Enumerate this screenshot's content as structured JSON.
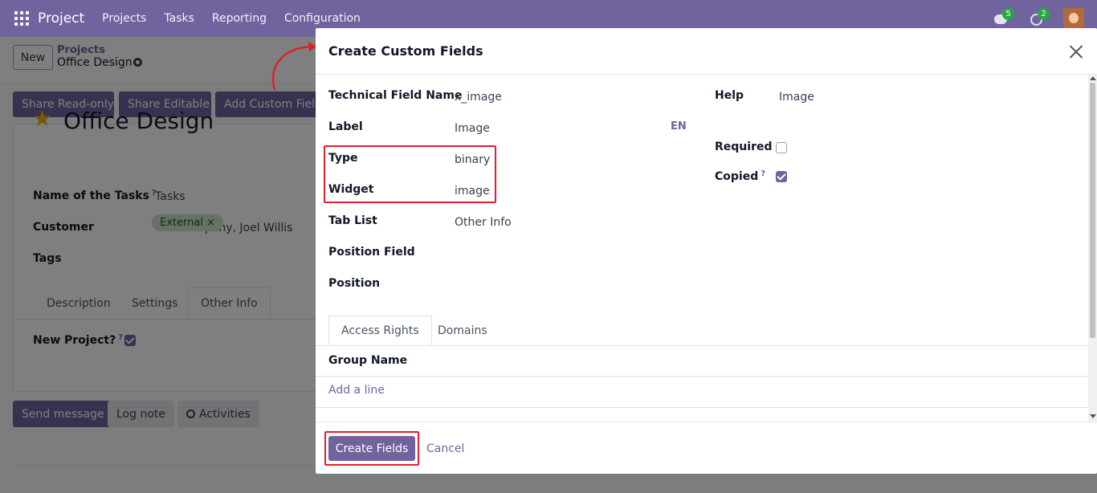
{
  "navbar": {
    "app_name": "Project",
    "menu": [
      "Projects",
      "Tasks",
      "Reporting",
      "Configuration"
    ],
    "messages_count": "5",
    "activities_count": "2"
  },
  "control_panel": {
    "new_label": "New",
    "breadcrumb_parent": "Projects",
    "breadcrumb_current": "Office Design"
  },
  "actions": {
    "share_readonly": "Share Read-only",
    "share_editable": "Share Editable",
    "add_custom_field": "Add Custom Field"
  },
  "form": {
    "title": "Office Design",
    "name_of_tasks_label": "Name of the Tasks",
    "name_of_tasks_hint": "?",
    "name_of_tasks_value": "Tasks",
    "customer_label": "Customer",
    "customer_value": "YourCompany, Joel Willis",
    "tags_label": "Tags",
    "tag_external": "External",
    "tag_remove": "×",
    "tabs": [
      "Description",
      "Settings",
      "Other Info"
    ],
    "new_project_label": "New Project?",
    "new_project_hint": "?",
    "new_project_checked": true
  },
  "chatter": {
    "send_message": "Send message",
    "log_note": "Log note",
    "activities": "Activities"
  },
  "modal": {
    "title": "Create Custom Fields",
    "technical_name_label": "Technical Field Name",
    "technical_name_value": "x_image",
    "label_label": "Label",
    "label_value": "Image",
    "lang": "EN",
    "type_label": "Type",
    "type_value": "binary",
    "widget_label": "Widget",
    "widget_value": "image",
    "tab_list_label": "Tab List",
    "tab_list_value": "Other Info",
    "position_field_label": "Position Field",
    "position_label": "Position",
    "help_label": "Help",
    "help_value": "Image",
    "required_label": "Required",
    "required_checked": false,
    "copied_label": "Copied",
    "copied_hint": "?",
    "copied_checked": true,
    "tabs": [
      "Access Rights",
      "Domains"
    ],
    "group_name_header": "Group Name",
    "add_line": "Add a line",
    "create_button": "Create Fields",
    "cancel_button": "Cancel"
  },
  "colors": {
    "brand": "#71639e",
    "annotation_red": "#e0202a"
  }
}
